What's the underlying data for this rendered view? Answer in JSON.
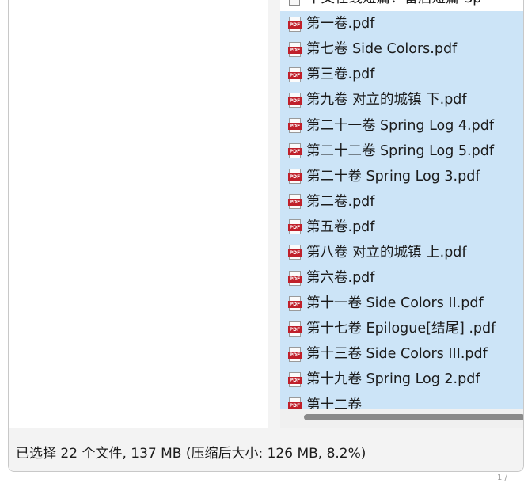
{
  "file_list": {
    "items": [
      {
        "name": "中文在线短篇：番后短篇 Sp",
        "icon": "document-icon"
      },
      {
        "name": "第一卷.pdf",
        "icon": "pdf-file-icon"
      },
      {
        "name": "第七卷 Side Colors.pdf",
        "icon": "pdf-file-icon"
      },
      {
        "name": "第三卷.pdf",
        "icon": "pdf-file-icon"
      },
      {
        "name": "第九卷 对立的城镇 下.pdf",
        "icon": "pdf-file-icon"
      },
      {
        "name": "第二十一卷 Spring Log 4.pdf",
        "icon": "pdf-file-icon"
      },
      {
        "name": "第二十二卷 Spring Log 5.pdf",
        "icon": "pdf-file-icon"
      },
      {
        "name": "第二十卷 Spring Log 3.pdf",
        "icon": "pdf-file-icon"
      },
      {
        "name": "第二卷.pdf",
        "icon": "pdf-file-icon"
      },
      {
        "name": "第五卷.pdf",
        "icon": "pdf-file-icon"
      },
      {
        "name": "第八卷 对立的城镇 上.pdf",
        "icon": "pdf-file-icon"
      },
      {
        "name": "第六卷.pdf",
        "icon": "pdf-file-icon"
      },
      {
        "name": "第十一卷 Side Colors II.pdf",
        "icon": "pdf-file-icon"
      },
      {
        "name": "第十七卷 Epilogue[结尾] .pdf",
        "icon": "pdf-file-icon"
      },
      {
        "name": "第十三卷 Side Colors III.pdf",
        "icon": "pdf-file-icon"
      },
      {
        "name": "第十九卷 Spring Log 2.pdf",
        "icon": "pdf-file-icon"
      },
      {
        "name": "第十二卷",
        "icon": "pdf-file-icon"
      }
    ],
    "pdf_badge": "PDF",
    "selection_color": "#cce4f7"
  },
  "status_bar": {
    "text": "已选择 22 个文件, 137 MB (压缩后大小: 126 MB, 8.2%)"
  },
  "corner_fragment": "1 /"
}
